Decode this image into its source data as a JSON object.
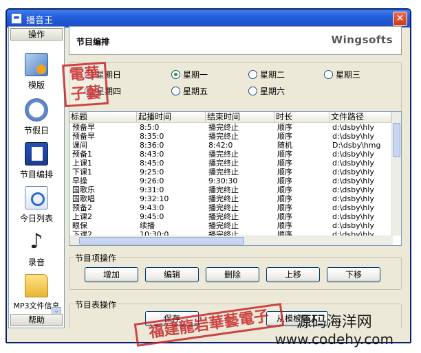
{
  "window": {
    "title": "播音王",
    "close_label": "✕",
    "sysmenu_label": "▬"
  },
  "sidebar": {
    "header": "操作",
    "items": [
      {
        "label": "模版",
        "icon": "template-icon"
      },
      {
        "label": "节假日",
        "icon": "holiday-clock-icon"
      },
      {
        "label": "节目编排",
        "icon": "program-edit-icon"
      },
      {
        "label": "今日列表",
        "icon": "today-list-icon"
      },
      {
        "label": "录音",
        "icon": "music-note-icon"
      },
      {
        "label": "MP3文件信息",
        "icon": "folder-icon"
      }
    ],
    "scroll_label": "⌄",
    "footer": "帮助"
  },
  "header": {
    "title": "节目编排",
    "brand": "Wingsofts"
  },
  "days": {
    "options": [
      "星期日",
      "星期一",
      "星期二",
      "星期三",
      "星期四",
      "星期五",
      "星期六"
    ],
    "selected": "星期一"
  },
  "table": {
    "columns": [
      "标题",
      "起播时间",
      "结束时间",
      "时长",
      "文件路径"
    ],
    "rows": [
      [
        "预备早",
        "8:5:0",
        "播完终止",
        "顺序",
        "d:\\dsby\\hly"
      ],
      [
        "预备早",
        "8:35:0",
        "播完终止",
        "顺序",
        "d:\\dsby\\hly"
      ],
      [
        "课间",
        "8:36:0",
        "8:42:0",
        "随机",
        "D:\\dsby\\hmg"
      ],
      [
        "预备1",
        "8:43:0",
        "播完终止",
        "顺序",
        "d:\\dsby\\hly"
      ],
      [
        "上课1",
        "8:45:0",
        "播完终止",
        "顺序",
        "d:\\dsby\\hly"
      ],
      [
        "下课1",
        "9:25:0",
        "播完终止",
        "顺序",
        "d:\\dsby\\hly"
      ],
      [
        "早操",
        "9:26:0",
        "9:30:30",
        "顺序",
        "d:\\dsby\\hly"
      ],
      [
        "国歌乐",
        "9:31:0",
        "播完终止",
        "顺序",
        "d:\\dsby\\hly"
      ],
      [
        "国歌唱",
        "9:32:10",
        "播完终止",
        "顺序",
        "d:\\dsby\\hly"
      ],
      [
        "预备2",
        "9:43:0",
        "播完终止",
        "顺序",
        "d:\\dsby\\hly"
      ],
      [
        "上课2",
        "9:45:0",
        "播完终止",
        "顺序",
        "d:\\dsby\\hly"
      ],
      [
        "眼保",
        "续播",
        "播完终止",
        "顺序",
        "d:\\dsby\\hly"
      ],
      [
        "下课2",
        "10:30:0",
        "播完终止",
        "顺序",
        "d:\\dsby\\hly"
      ]
    ]
  },
  "item_ops": {
    "legend": "节目项操作",
    "buttons": [
      "增加",
      "编辑",
      "删除",
      "上移",
      "下移"
    ]
  },
  "table_ops": {
    "legend": "节目表操作",
    "buttons": [
      "保存",
      "从模板导入"
    ]
  },
  "stamps": {
    "small": "電子藝華",
    "large": "福建龍岩華藝電子"
  },
  "watermark": {
    "line1": "源码海洋网",
    "line2": "www.codehy.com"
  }
}
